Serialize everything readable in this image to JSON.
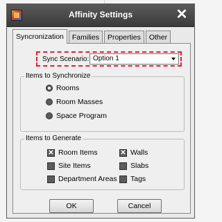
{
  "window": {
    "title": "Affinity Settings",
    "close_glyph": "✕"
  },
  "tabs": [
    {
      "label": "Syncronization",
      "active": true
    },
    {
      "label": "Families",
      "active": false
    },
    {
      "label": "Properties",
      "active": false
    },
    {
      "label": "Other",
      "active": false
    }
  ],
  "sync": {
    "label": "Sync Scenario:",
    "selected": "Option 1",
    "highlight_color": "#e0212d"
  },
  "items_to_sync": {
    "title": "Items to Synchronize",
    "options": [
      {
        "label": "Rooms",
        "selected": true
      },
      {
        "label": "Room Masses",
        "selected": false
      },
      {
        "label": "Space Program",
        "selected": false
      }
    ]
  },
  "items_to_generate": {
    "title": "Items to Generate",
    "checkboxes": [
      {
        "label": "Room Items",
        "checked": true
      },
      {
        "label": "Walls",
        "checked": true
      },
      {
        "label": "Site Items",
        "checked": false
      },
      {
        "label": "Slabs",
        "checked": false
      },
      {
        "label": "Department Areas",
        "checked": false
      },
      {
        "label": "Tags",
        "checked": false
      }
    ]
  },
  "buttons": {
    "ok": "OK",
    "cancel": "Cancel"
  }
}
